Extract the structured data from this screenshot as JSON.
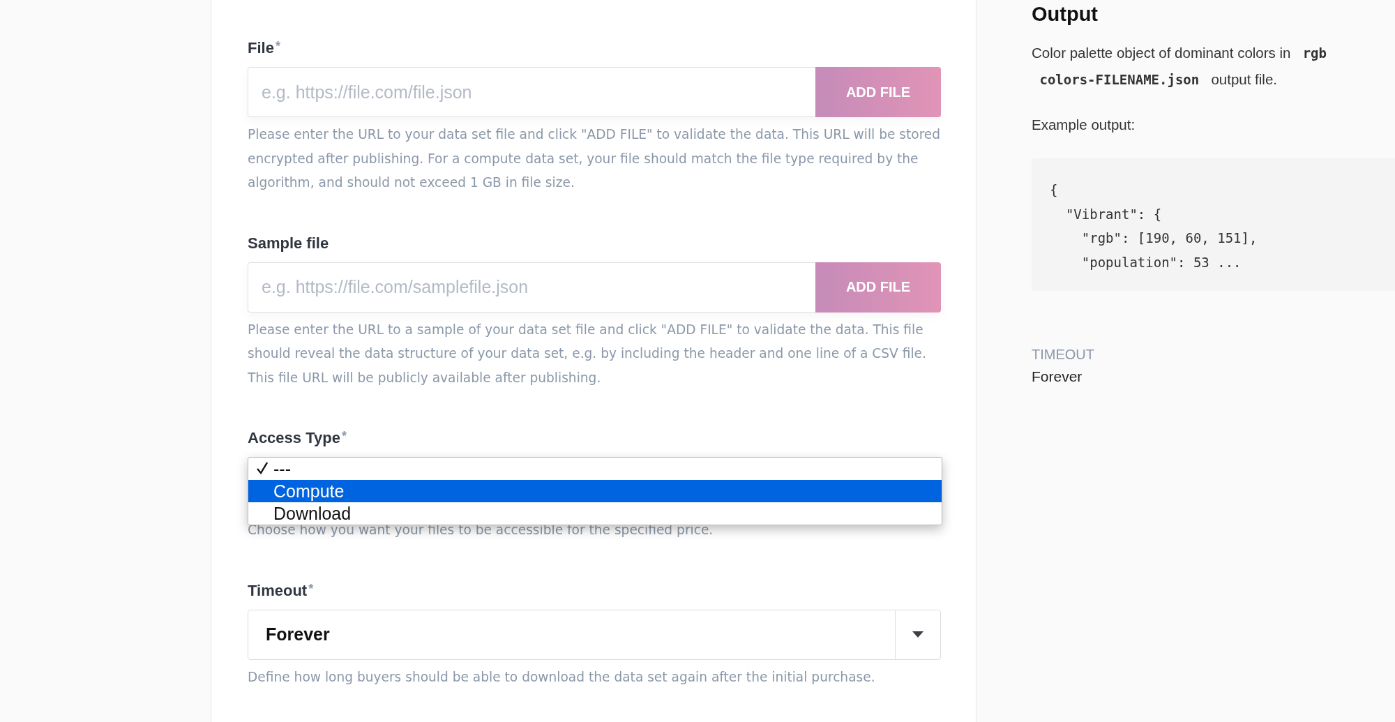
{
  "form": {
    "fields": [
      {
        "kind": "url",
        "label": "File",
        "required": true,
        "required_mark": "*",
        "placeholder": "e.g. https://file.com/file.json",
        "button": "ADD FILE",
        "help": "Please enter the URL to your data set file and click \"ADD FILE\" to validate the data. This URL will be stored encrypted after publishing. For a compute data set, your file should match the file type required by the algorithm, and should not exceed 1 GB in file size."
      },
      {
        "kind": "url",
        "label": "Sample file",
        "required": false,
        "placeholder": "e.g. https://file.com/samplefile.json",
        "button": "ADD FILE",
        "help": "Please enter the URL to a sample of your data set file and click \"ADD FILE\" to validate the data. This file should reveal the data structure of your data set, e.g. by including the header and one line of a CSV file. This file URL will be publicly available after publishing."
      },
      {
        "kind": "open-select",
        "label": "Access Type",
        "required": true,
        "required_mark": "*",
        "options": [
          {
            "label": "---",
            "checked": true,
            "selected": false
          },
          {
            "label": "Compute",
            "checked": false,
            "selected": true
          },
          {
            "label": "Download",
            "checked": false,
            "selected": false
          }
        ],
        "help": "Choose how you want your files to be accessible for the specified price."
      },
      {
        "kind": "select",
        "label": "Timeout",
        "required": true,
        "required_mark": "*",
        "value": "Forever",
        "help": "Define how long buyers should be able to download the data set again after the initial purchase."
      }
    ]
  },
  "output": {
    "title": "Output",
    "description": [
      [
        {
          "kind": "text",
          "text": "Color palette object of dominant colors in "
        },
        {
          "kind": "code",
          "text": "rgb"
        }
      ],
      [
        {
          "kind": "code",
          "text": "colors-FILENAME.json"
        },
        {
          "kind": "text",
          "text": " output file."
        }
      ]
    ],
    "example_label": "Example output:",
    "code_lines": [
      "{",
      "  \"Vibrant\": {",
      "    \"rgb\": [190, 60, 151],",
      "    \"population\": 53 ..."
    ],
    "timeout_label": "TIMEOUT",
    "timeout_value": "Forever"
  }
}
